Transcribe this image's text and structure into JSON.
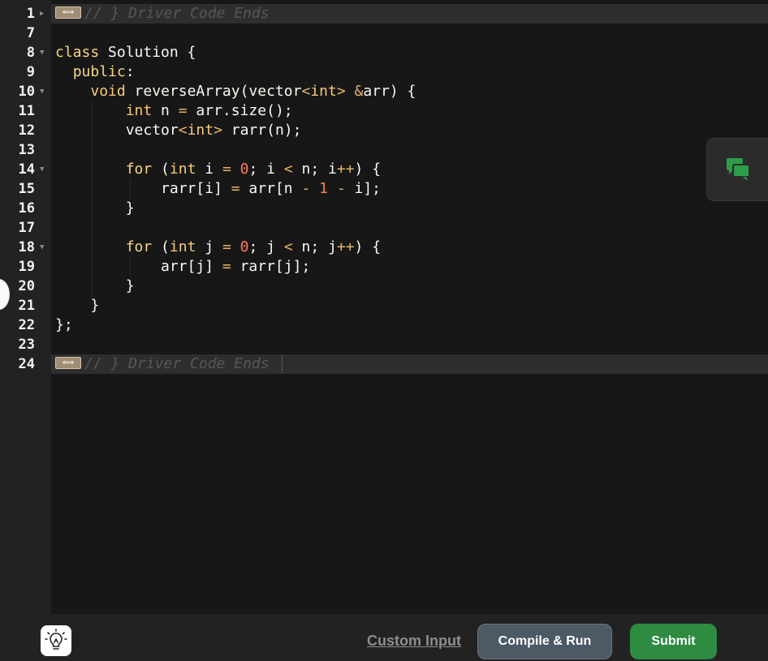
{
  "editor": {
    "lines": [
      {
        "n": "1",
        "fold": "right",
        "text": "// } Driver Code Ends",
        "collapsed": true
      },
      {
        "n": "7",
        "text": ""
      },
      {
        "n": "8",
        "fold": "down",
        "text": "class Solution {"
      },
      {
        "n": "9",
        "text": "  public:"
      },
      {
        "n": "10",
        "fold": "down",
        "text": "    void reverseArray(vector<int> &arr) {"
      },
      {
        "n": "11",
        "text": "        int n = arr.size();"
      },
      {
        "n": "12",
        "text": "        vector<int> rarr(n);"
      },
      {
        "n": "13",
        "text": ""
      },
      {
        "n": "14",
        "fold": "down",
        "text": "        for (int i = 0; i < n; i++) {"
      },
      {
        "n": "15",
        "text": "            rarr[i] = arr[n - 1 - i];"
      },
      {
        "n": "16",
        "text": "        }"
      },
      {
        "n": "17",
        "text": ""
      },
      {
        "n": "18",
        "fold": "down",
        "text": "        for (int j = 0; j < n; j++) {"
      },
      {
        "n": "19",
        "text": "            arr[j] = rarr[j];"
      },
      {
        "n": "20",
        "text": "        }"
      },
      {
        "n": "21",
        "text": "    }"
      },
      {
        "n": "22",
        "text": "};"
      },
      {
        "n": "23",
        "text": ""
      },
      {
        "n": "24",
        "text": "// } Driver Code Ends",
        "collapsed": true
      }
    ]
  },
  "icons": {
    "chat": "chat-bubbles-icon",
    "hint": "lightbulb-icon"
  },
  "footer": {
    "custom_input": "Custom Input",
    "compile_run": "Compile & Run",
    "submit": "Submit"
  },
  "colors": {
    "submit": "#2e8b41",
    "compile": "#4c5a66",
    "chat_icon": "#2e9d4a"
  }
}
